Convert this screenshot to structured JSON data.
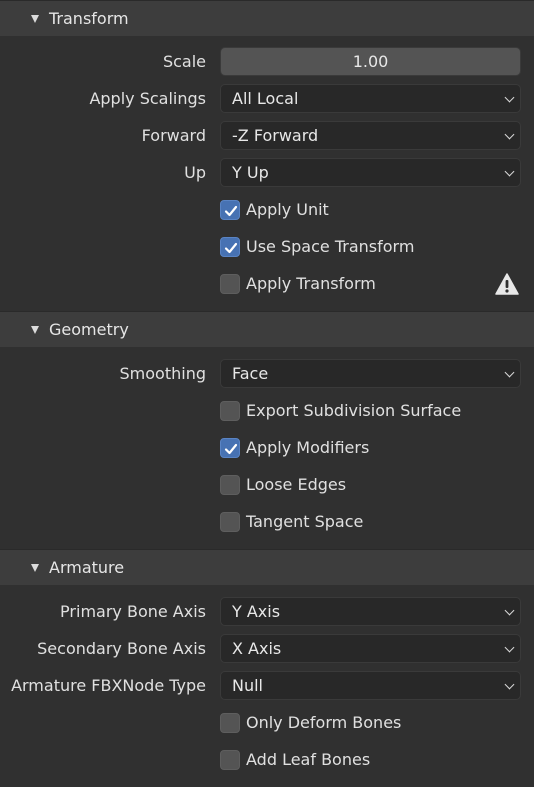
{
  "transform": {
    "title": "Transform",
    "scale": {
      "label": "Scale",
      "value": "1.00"
    },
    "apply_scalings": {
      "label": "Apply Scalings",
      "value": "All Local"
    },
    "forward": {
      "label": "Forward",
      "value": "-Z Forward"
    },
    "up": {
      "label": "Up",
      "value": "Y Up"
    },
    "apply_unit": {
      "label": "Apply Unit",
      "checked": true
    },
    "use_space_transform": {
      "label": "Use Space Transform",
      "checked": true
    },
    "apply_transform": {
      "label": "Apply Transform",
      "checked": false,
      "warning_icon": "warning-icon"
    }
  },
  "geometry": {
    "title": "Geometry",
    "smoothing": {
      "label": "Smoothing",
      "value": "Face"
    },
    "export_subdivision_surface": {
      "label": "Export Subdivision Surface",
      "checked": false
    },
    "apply_modifiers": {
      "label": "Apply Modifiers",
      "checked": true
    },
    "loose_edges": {
      "label": "Loose Edges",
      "checked": false
    },
    "tangent_space": {
      "label": "Tangent Space",
      "checked": false
    }
  },
  "armature": {
    "title": "Armature",
    "primary_bone_axis": {
      "label": "Primary Bone Axis",
      "value": "Y Axis"
    },
    "secondary_bone_axis": {
      "label": "Secondary Bone Axis",
      "value": "X Axis"
    },
    "node_type": {
      "label": "Armature FBXNode Type",
      "value": "Null"
    },
    "only_deform_bones": {
      "label": "Only Deform Bones",
      "checked": false
    },
    "add_leaf_bones": {
      "label": "Add Leaf Bones",
      "checked": false
    }
  },
  "colors": {
    "background": "#303030",
    "header": "#3d3d3d",
    "checkbox_on": "#4772b3",
    "field_dark": "#282828",
    "field_numeric": "#545454"
  }
}
